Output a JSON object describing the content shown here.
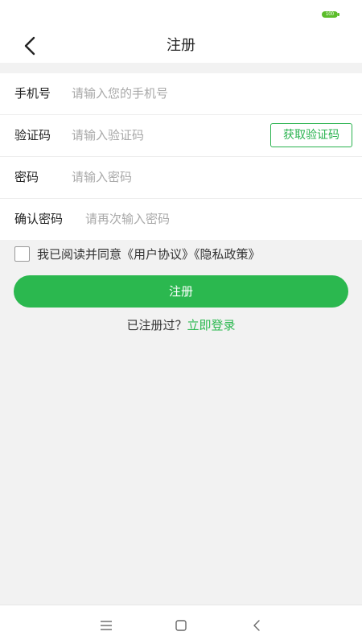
{
  "status_bar": {
    "battery": "100"
  },
  "header": {
    "title": "注册"
  },
  "form": {
    "phone": {
      "label": "手机号",
      "placeholder": "请输入您的手机号",
      "value": ""
    },
    "code": {
      "label": "验证码",
      "placeholder": "请输入验证码",
      "value": "",
      "button_label": "获取验证码"
    },
    "password": {
      "label": "密码",
      "placeholder": "请输入密码",
      "value": ""
    },
    "confirm": {
      "label": "确认密码",
      "placeholder": "请再次输入密码",
      "value": ""
    }
  },
  "agreement": {
    "checked": false,
    "prefix": "我已阅读并同意",
    "user_agreement": "《用户协议》",
    "privacy_policy": "《隐私政策》"
  },
  "submit_label": "注册",
  "login_prompt": {
    "text": "已注册过？",
    "link": "立即登录"
  },
  "nav": {
    "icons": [
      "menu-icon",
      "home-icon",
      "back-icon"
    ]
  },
  "colors": {
    "accent": "#2bb84f",
    "background": "#f2f2f2",
    "placeholder": "#a8a8a8"
  }
}
